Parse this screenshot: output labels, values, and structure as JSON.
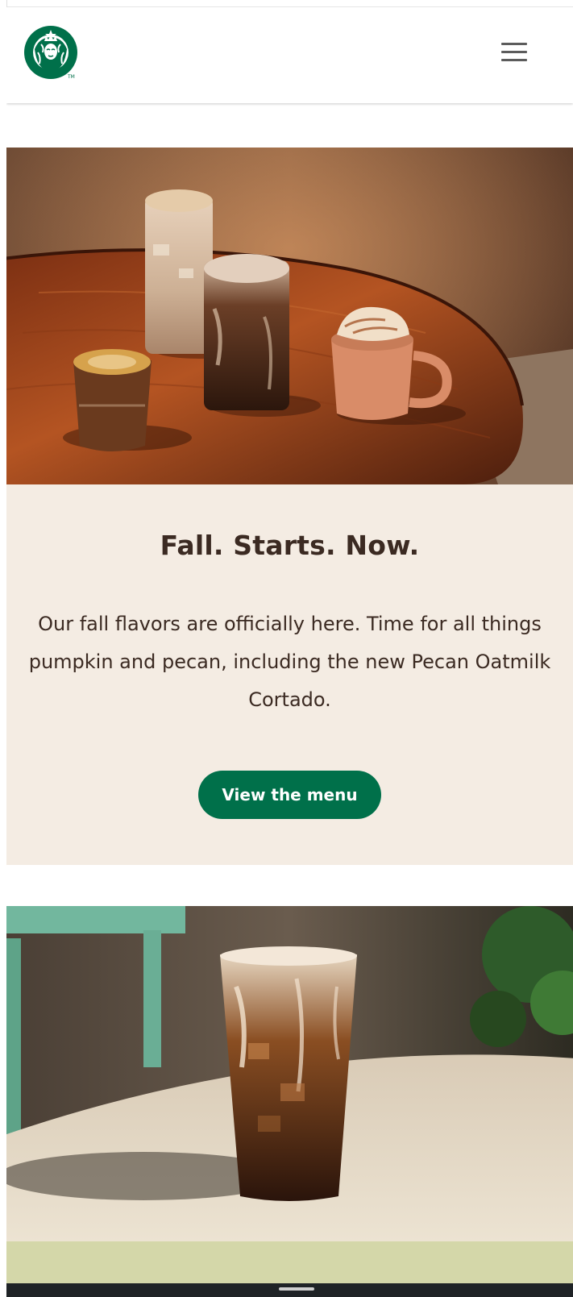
{
  "header": {
    "logo_name": "starbucks-siren-logo",
    "menu_icon": "hamburger-menu-icon"
  },
  "promo1": {
    "image": "fall drinks on wooden table",
    "title": "Fall. Starts. Now.",
    "body": "Our fall flavors are officially here. Time for all things pumpkin and pecan, including the new Pecan Oatmilk Cortado.",
    "cta_label": "View the menu",
    "background_color": "#f4ece3",
    "button_color": "#00704a"
  },
  "promo2": {
    "image": "iced coffee with cream on table",
    "background_color": "#d4d7a9"
  },
  "colors": {
    "brand_green": "#00704a",
    "heading_brown": "#3b2a22"
  }
}
